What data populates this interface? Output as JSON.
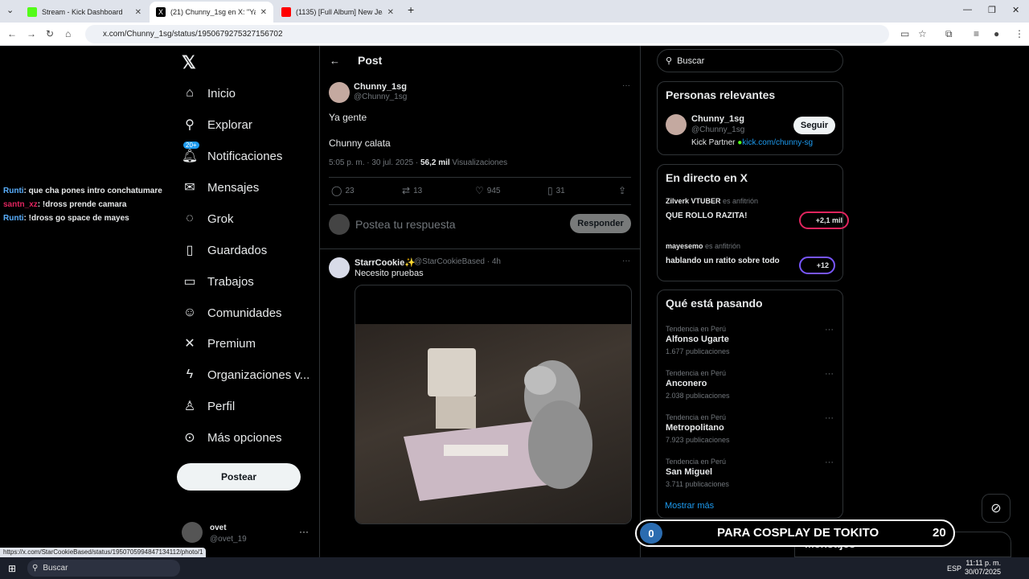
{
  "tabs": [
    {
      "title": "Stream - Kick Dashboard",
      "color": "#53fc18"
    },
    {
      "title": "(21) Chunny_1sg en X: \"Ya gente",
      "color": "#000000"
    },
    {
      "title": "(1135) [Full Album] New Jea",
      "color": "#ff0000"
    }
  ],
  "address": "x.com/Chunny_1sg/status/1950679275327156702",
  "chat": [
    {
      "user": "Runti",
      "msg": ": que cha pones intro conchatumare"
    },
    {
      "user": "santn_xz",
      "msg": ": !dross prende camara"
    },
    {
      "user": "Runti",
      "msg": ": !dross go space de mayes"
    }
  ],
  "nav": {
    "items": [
      "Inicio",
      "Explorar",
      "Notificaciones",
      "Mensajes",
      "Grok",
      "Guardados",
      "Trabajos",
      "Comunidades",
      "Premium",
      "Organizaciones v...",
      "Perfil",
      "Más opciones"
    ],
    "badge": "20+",
    "post_button": "Postear",
    "me_name": "ovet",
    "me_handle": "@ovet_19"
  },
  "post": {
    "header": "Post",
    "name": "Chunny_1sg",
    "handle": "@Chunny_1sg",
    "line1": "Ya gente",
    "line2": "Chunny calata",
    "time": "5:05 p. m. · 30 jul. 2025 · ",
    "views": "56,2 mil",
    "views_label": " Visualizaciones",
    "replies": "23",
    "reposts": "13",
    "likes": "945",
    "bookmarks": "31"
  },
  "reply": {
    "placeholder": "Postea tu respuesta",
    "button": "Responder"
  },
  "reply_post": {
    "name": "StarrCookie✨",
    "handle": "@StarCookieBased · 4h",
    "text": "Necesito pruebas"
  },
  "sidebar": {
    "search_placeholder": "Buscar",
    "relevant_title": "Personas relevantes",
    "relevant_name": "Chunny_1sg",
    "relevant_handle": "@Chunny_1sg",
    "relevant_bio": "Kick Partner",
    "relevant_link": "kick.com/chunny-sg",
    "follow": "Seguir",
    "live_title": "En directo en X",
    "live": [
      {
        "host": "Zilverk VTUBER",
        "hostlbl": " es anfitrión",
        "title": "QUE ROLLO RAZITA!",
        "count": "+2,1 mil"
      },
      {
        "host": "mayesemo",
        "hostlbl": " es anfitrión",
        "title": "hablando un ratito sobre todo",
        "count": "+12"
      }
    ],
    "trends_title": "Qué está pasando",
    "trends": [
      {
        "cat": "Tendencia en Perú",
        "name": "Alfonso Ugarte",
        "count": "1.677 publicaciones"
      },
      {
        "cat": "Tendencia en Perú",
        "name": "Anconero",
        "count": "2.038 publicaciones"
      },
      {
        "cat": "Tendencia en Perú",
        "name": "Metropolitano",
        "count": "7.923 publicaciones"
      },
      {
        "cat": "Tendencia en Perú",
        "name": "San Miguel",
        "count": "3.711 publicaciones"
      }
    ],
    "show_more": "Mostrar más"
  },
  "overlay": {
    "left": "0",
    "text": "PARA COSPLAY DE TOKITO",
    "right": "20"
  },
  "messages_dock": "Mensajes",
  "status_url": "https://x.com/StarCookieBased/status/1950705994847134112/photo/1",
  "taskbar": {
    "search": "Buscar",
    "lang": "ESP",
    "time": "11:11 p. m.",
    "date": "30/07/2025"
  }
}
